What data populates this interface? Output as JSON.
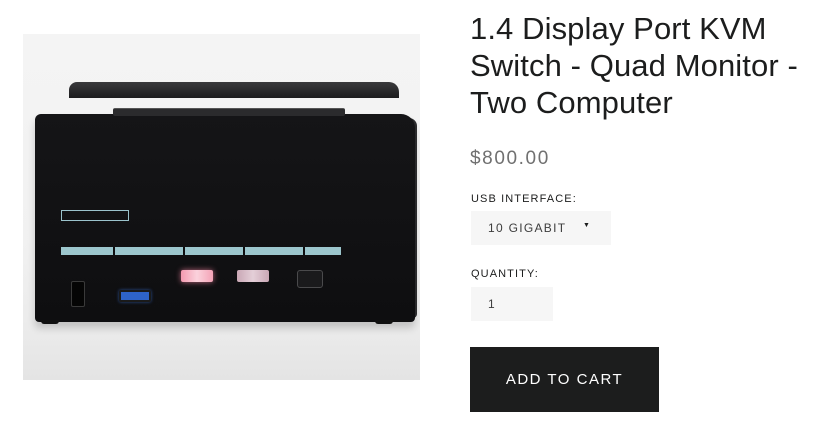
{
  "product": {
    "image_alt": "KVM switch product photo",
    "title": "1.4 Display Port KVM Switch - Quad Monitor - Two Computer",
    "price": "$800.00"
  },
  "options": {
    "usb_label": "USB INTERFACE:",
    "usb_selected": "10 GIGABIT",
    "quantity_label": "QUANTITY:",
    "quantity_value": "1"
  },
  "actions": {
    "add_to_cart": "ADD TO CART"
  },
  "colors": {
    "button_bg": "#1c1d1d",
    "field_bg": "#f6f6f6",
    "price_text": "#707070"
  }
}
